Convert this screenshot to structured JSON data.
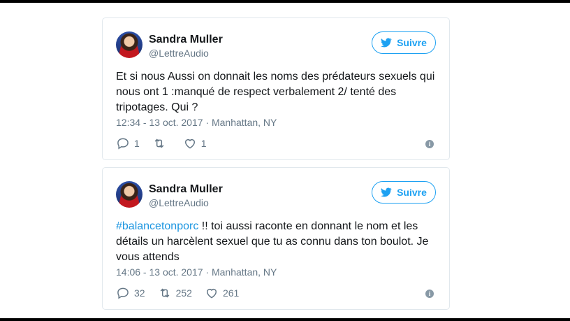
{
  "tweets": [
    {
      "author_name": "Sandra Muller",
      "handle": "@LettreAudio",
      "follow_label": "Suivre",
      "text_hashtag": "",
      "text_body": "Et si nous Aussi on donnait les noms des prédateurs sexuels qui nous ont 1 :manqué de respect verbalement 2/ tenté des tripotages. Qui ?",
      "timestamp": "12:34 - 13 oct. 2017 · Manhattan, NY",
      "replies": "1",
      "retweets": "",
      "likes": "1",
      "info_icon": "i"
    },
    {
      "author_name": "Sandra Muller",
      "handle": "@LettreAudio",
      "follow_label": "Suivre",
      "text_hashtag": "#balancetonporc",
      "text_body": " !! toi aussi raconte en donnant le nom et les détails un harcèlent sexuel que tu as connu dans ton boulot. Je vous attends",
      "timestamp": "14:06 - 13 oct. 2017 · Manhattan, NY",
      "replies": "32",
      "retweets": "252",
      "likes": "261",
      "info_icon": "i"
    }
  ],
  "colors": {
    "accent": "#1da1f2",
    "hashtag": "#1b95e0",
    "muted": "#657786",
    "border": "#e1e8ed"
  },
  "icons": [
    "twitter-bird-icon",
    "reply-icon",
    "retweet-icon",
    "heart-icon",
    "info-icon"
  ]
}
